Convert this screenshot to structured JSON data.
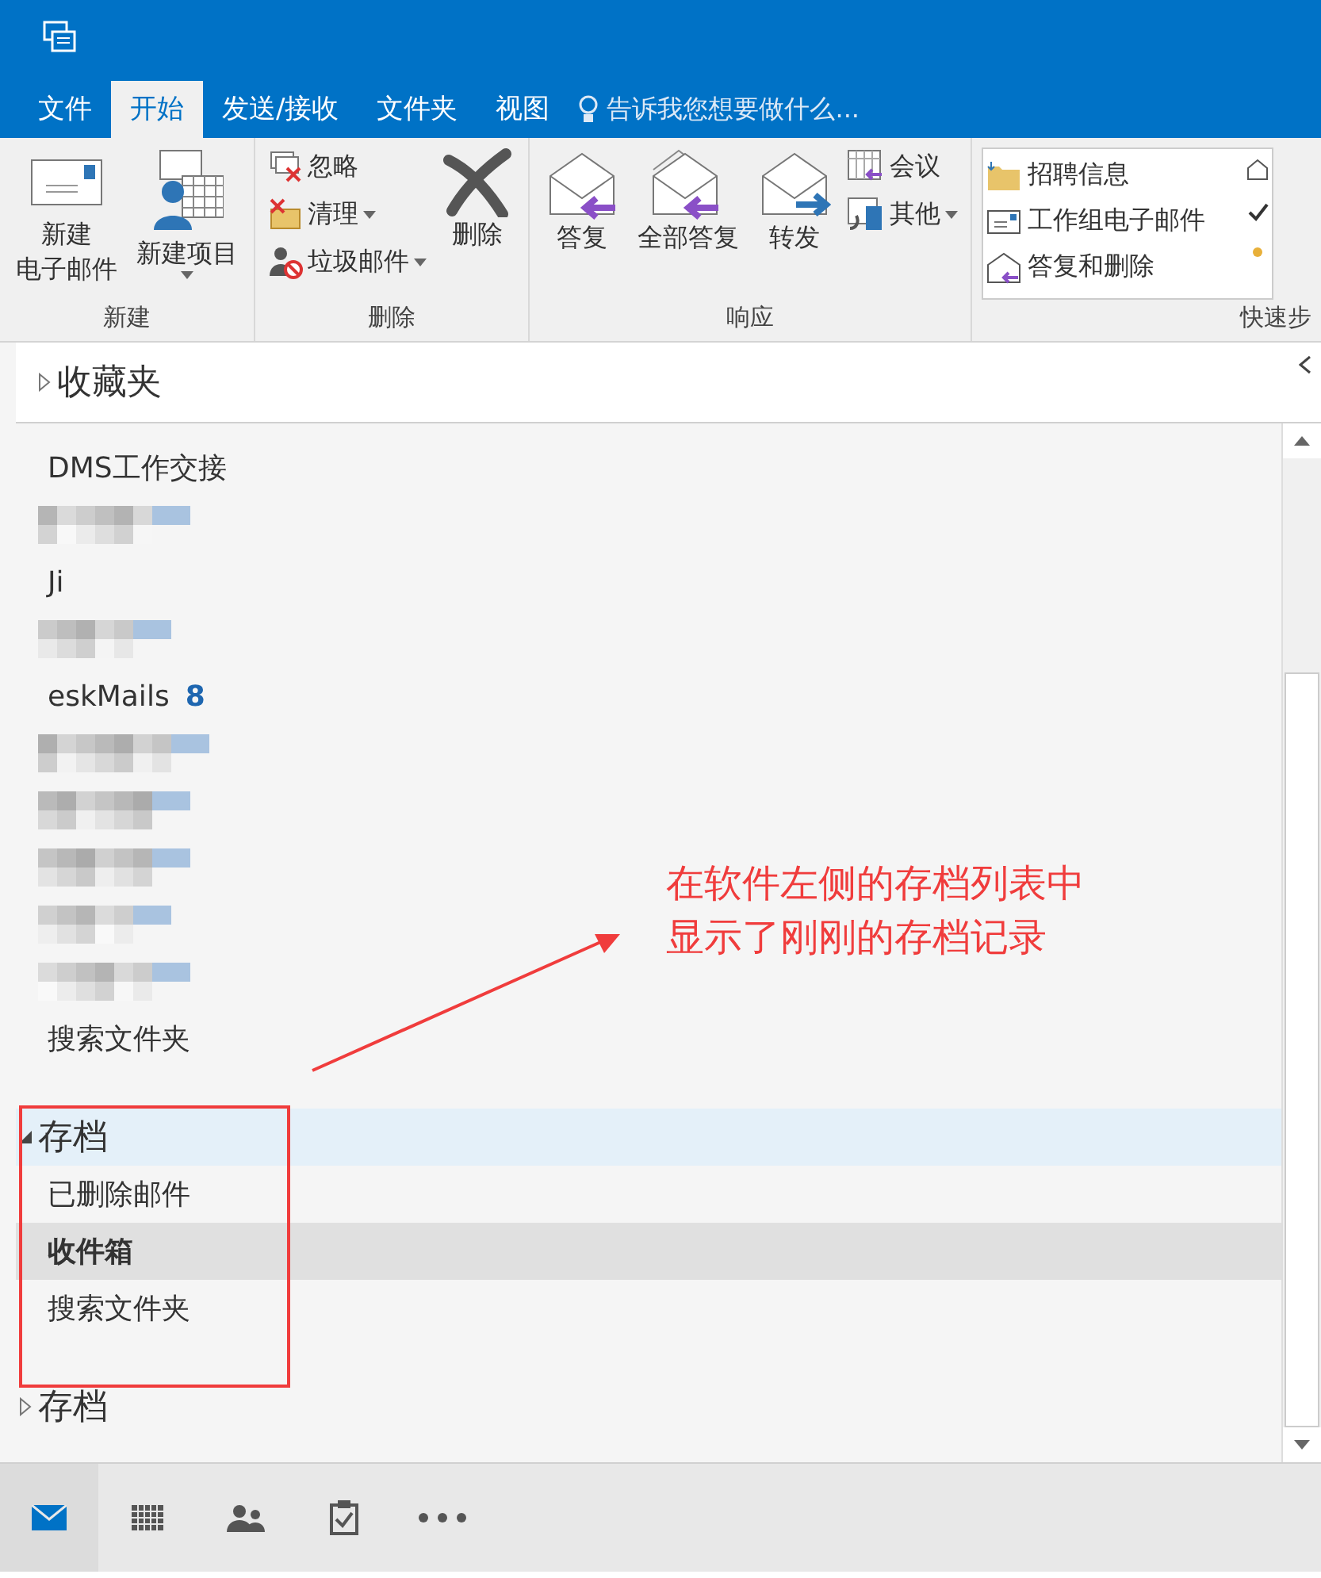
{
  "tabs": [
    {
      "label": "文件",
      "selected": false
    },
    {
      "label": "开始",
      "selected": true
    },
    {
      "label": "发送/接收",
      "selected": false
    },
    {
      "label": "文件夹",
      "selected": false
    },
    {
      "label": "视图",
      "selected": false
    }
  ],
  "tell_me": "告诉我您想要做什么...",
  "ribbon": [
    {
      "label": "新建",
      "buttons": [
        {
          "kind": "large",
          "label": [
            "新建",
            "电子邮件"
          ]
        },
        {
          "kind": "large",
          "label": [
            "新建项目"
          ],
          "dropdown": true
        }
      ]
    },
    {
      "label": "删除",
      "buttons": [
        {
          "kind": "small",
          "label": [
            "忽略"
          ]
        },
        {
          "kind": "small",
          "label": [
            "清理"
          ],
          "dropdown": true
        },
        {
          "kind": "small",
          "label": [
            "垃圾邮件"
          ],
          "dropdown": true
        },
        {
          "kind": "large",
          "label": [
            "删除"
          ]
        }
      ]
    },
    {
      "label": "响应",
      "buttons": [
        {
          "kind": "large",
          "label": [
            "答复"
          ]
        },
        {
          "kind": "large",
          "label": [
            "全部答复"
          ]
        },
        {
          "kind": "large",
          "label": [
            "转发"
          ]
        },
        {
          "kind": "small",
          "label": [
            "会议"
          ]
        },
        {
          "kind": "small",
          "label": [
            "其他"
          ],
          "dropdown": true
        }
      ]
    },
    {
      "label": "快速步",
      "buttons": [
        {
          "kind": "quick",
          "label": [
            "招聘信息"
          ]
        },
        {
          "kind": "quick",
          "label": [
            "工作组电子邮件"
          ]
        },
        {
          "kind": "quick",
          "label": [
            "答复和删除"
          ]
        }
      ]
    }
  ],
  "favorites": {
    "label": "收藏夹",
    "expanded": false
  },
  "folders": [
    {
      "kind": "folder",
      "name": "DMS工作交接"
    },
    {
      "kind": "redacted"
    },
    {
      "kind": "folder",
      "name": "Ji"
    },
    {
      "kind": "redacted"
    },
    {
      "kind": "folder",
      "name": "eskMails",
      "count": "8"
    },
    {
      "kind": "redacted"
    },
    {
      "kind": "redacted"
    },
    {
      "kind": "redacted"
    },
    {
      "kind": "redacted"
    },
    {
      "kind": "redacted"
    },
    {
      "kind": "folder",
      "name": "搜索文件夹"
    }
  ],
  "archives": [
    {
      "label": "存档",
      "expanded": true,
      "selected": true,
      "children": [
        {
          "name": "已删除邮件",
          "selected": false
        },
        {
          "name": "收件箱",
          "selected": true
        },
        {
          "name": "搜索文件夹",
          "selected": false
        }
      ]
    },
    {
      "label": "存档",
      "expanded": false,
      "selected": false
    }
  ],
  "annotation": [
    "在软件左侧的存档列表中",
    "显示了刚刚的存档记录"
  ],
  "nav": [
    {
      "selected": true
    },
    {
      "selected": false
    },
    {
      "selected": false
    },
    {
      "selected": false
    },
    {
      "selected": false
    }
  ]
}
